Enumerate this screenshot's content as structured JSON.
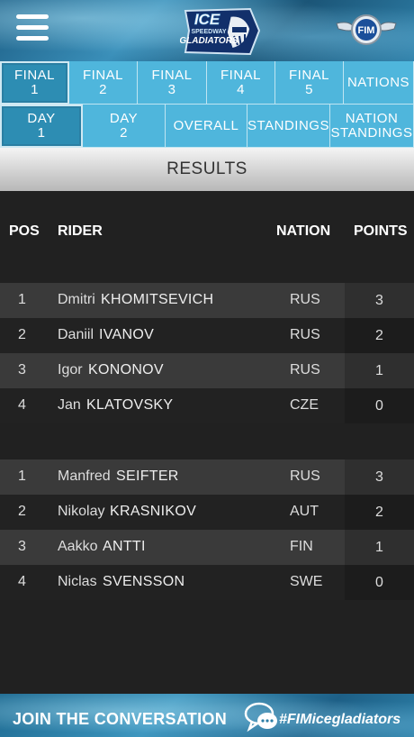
{
  "header": {
    "menu_icon": "hamburger-menu-icon",
    "logo_ice_lines": [
      "ICE",
      "SPEEDWAY",
      "GLADIATORS"
    ],
    "logo_fim": "FIM"
  },
  "tabs_row1": [
    {
      "label": "FINAL",
      "num": "1",
      "active": true
    },
    {
      "label": "FINAL",
      "num": "2",
      "active": false
    },
    {
      "label": "FINAL",
      "num": "3",
      "active": false
    },
    {
      "label": "FINAL",
      "num": "4",
      "active": false
    },
    {
      "label": "FINAL",
      "num": "5",
      "active": false
    },
    {
      "label": "NATIONS",
      "num": "",
      "active": false
    }
  ],
  "tabs_row2": [
    {
      "label": "DAY",
      "num": "1",
      "active": true
    },
    {
      "label": "DAY",
      "num": "2",
      "active": false
    },
    {
      "label": "OVERALL",
      "num": "",
      "active": false
    },
    {
      "label": "STANDINGS",
      "num": "",
      "active": false
    },
    {
      "label": "NATION",
      "num": "STANDINGS",
      "active": false
    }
  ],
  "results_title": "RESULTS",
  "table": {
    "headers": {
      "pos": "POS",
      "rider": "RIDER",
      "nation": "NATION",
      "points": "POINTS"
    },
    "groups": [
      [
        {
          "pos": "1",
          "first": "Dmitri",
          "last": "KHOMITSEVICH",
          "nation": "RUS",
          "points": "3"
        },
        {
          "pos": "2",
          "first": "Daniil",
          "last": "IVANOV",
          "nation": "RUS",
          "points": "2"
        },
        {
          "pos": "3",
          "first": "Igor",
          "last": "KONONOV",
          "nation": "RUS",
          "points": "1"
        },
        {
          "pos": "4",
          "first": "Jan",
          "last": "KLATOVSKY",
          "nation": "CZE",
          "points": "0"
        }
      ],
      [
        {
          "pos": "1",
          "first": "Manfred",
          "last": "SEIFTER",
          "nation": "RUS",
          "points": "3"
        },
        {
          "pos": "2",
          "first": "Nikolay",
          "last": "KRASNIKOV",
          "nation": "AUT",
          "points": "2"
        },
        {
          "pos": "3",
          "first": "Aakko",
          "last": "ANTTI",
          "nation": "FIN",
          "points": "1"
        },
        {
          "pos": "4",
          "first": "Niclas",
          "last": "SVENSSON",
          "nation": "SWE",
          "points": "0"
        }
      ]
    ]
  },
  "footer": {
    "cta": "JOIN THE CONVERSATION",
    "chat_icon": "chat-bubbles-icon",
    "hashtag": "#FIMicegladiators"
  }
}
